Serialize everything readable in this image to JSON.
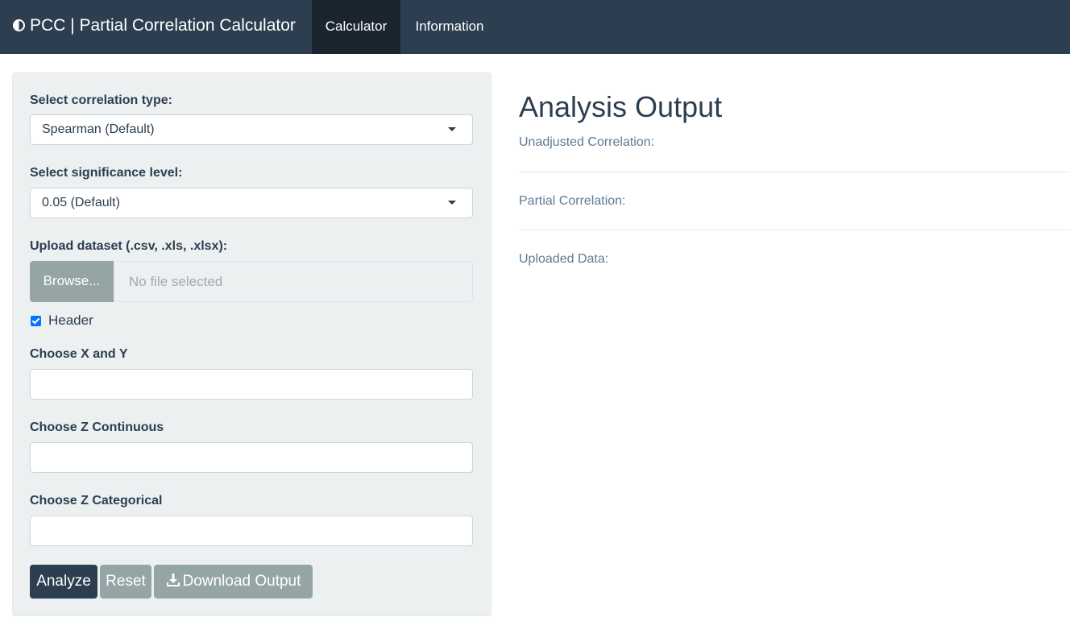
{
  "navbar": {
    "brand_icon": "half-circle-icon",
    "brand": "PCC | Partial Correlation Calculator",
    "tabs": [
      {
        "label": "Calculator",
        "active": true
      },
      {
        "label": "Information",
        "active": false
      }
    ]
  },
  "sidebar": {
    "correlation_type": {
      "label": "Select correlation type:",
      "value": "Spearman (Default)"
    },
    "significance_level": {
      "label": "Select significance level:",
      "value": "0.05 (Default)"
    },
    "upload": {
      "label": "Upload dataset (.csv, .xls, .xlsx):",
      "browse_label": "Browse...",
      "file_status": "No file selected"
    },
    "header_checkbox": {
      "label": "Header",
      "checked": true
    },
    "choose_xy": {
      "label": "Choose X and Y",
      "value": ""
    },
    "choose_z_continuous": {
      "label": "Choose Z Continuous",
      "value": ""
    },
    "choose_z_categorical": {
      "label": "Choose Z Categorical",
      "value": ""
    },
    "buttons": {
      "analyze": "Analyze",
      "reset": "Reset",
      "download": "Download Output",
      "download_icon": "download-icon"
    }
  },
  "main": {
    "heading": "Analysis Output",
    "unadjusted_label": "Unadjusted Correlation:",
    "partial_label": "Partial Correlation:",
    "uploaded_label": "Uploaded Data:"
  },
  "colors": {
    "navbar": "#2c3e50",
    "active_tab": "#1a252f",
    "primary_button": "#2c3e50",
    "secondary_button": "#95a5a6",
    "panel": "#ecf0f1",
    "output_label": "#5e7a95"
  }
}
